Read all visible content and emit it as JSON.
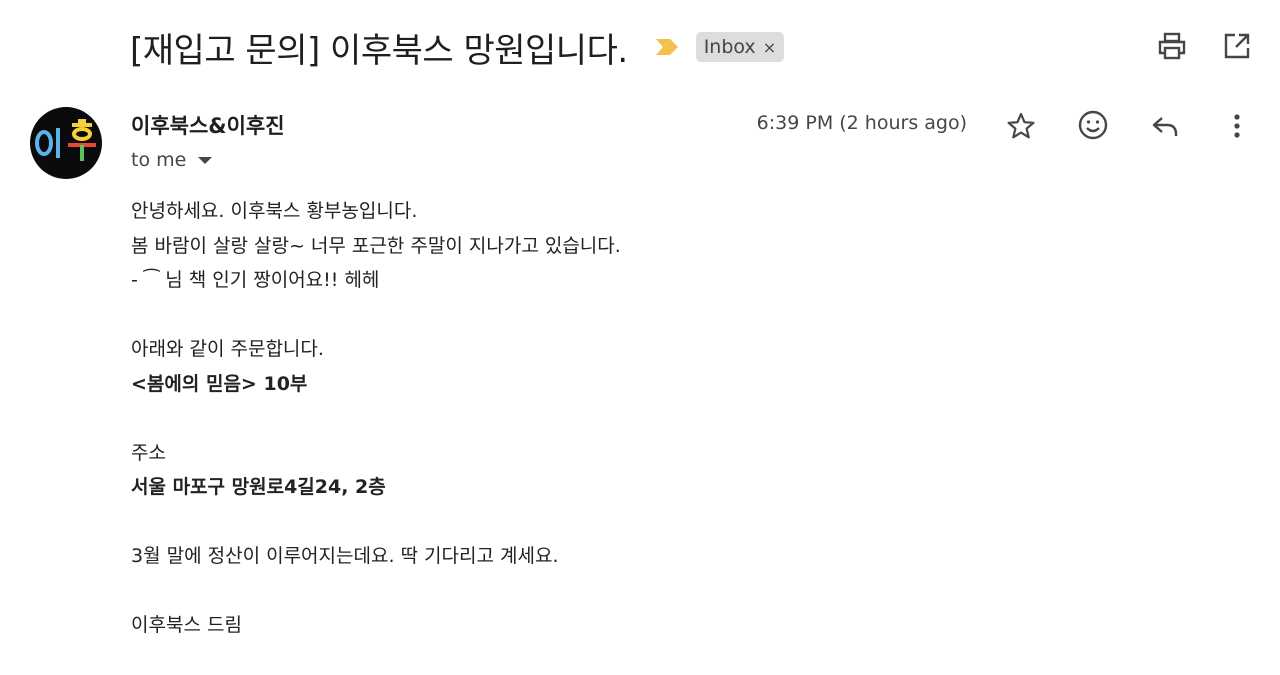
{
  "email": {
    "subject": "[재입고 문의] 이후북스 망원입니다.",
    "label": "Inbox",
    "label_remove": "×",
    "sender": {
      "name": "이후북스&이후진",
      "avatar_text": "이후",
      "recipient": "to me"
    },
    "timestamp": "6:39 PM (2 hours ago)",
    "body": {
      "l1": "안녕하세요. 이후북스 황부농입니다.",
      "l2": "봄 바람이 살랑 살랑~ 너무 포근한 주말이 지나가고 있습니다.",
      "l3": "‐ ⁀ 님 책 인기 짱이어요!! 헤헤",
      "l4": "아래와 같이 주문합니다.",
      "l5": "<봄에의 믿음> 10부",
      "l6": "주소",
      "l7": "서울 마포구 망원로4길24, 2층",
      "l8": "3월 말에 정산이 이루어지는데요. 딱 기다리고 계세요.",
      "l9": "이후북스 드림"
    }
  },
  "icons": {
    "importance": "importance-marker-icon",
    "print": "print-icon",
    "open_new": "open-in-new-window-icon",
    "star": "star-icon",
    "emoji": "emoji-reaction-icon",
    "reply": "reply-icon",
    "more": "more-vert-icon"
  },
  "colors": {
    "importance": "#f2c14e",
    "chip_bg": "#dddddd",
    "avatar_bg": "#0b0b0b",
    "avatar_char1": "#5ab4ea",
    "avatar_char2_top": "#f5d03b",
    "avatar_char2_bottom": "#5cc25b",
    "avatar_char2_bar": "#e8453c"
  }
}
